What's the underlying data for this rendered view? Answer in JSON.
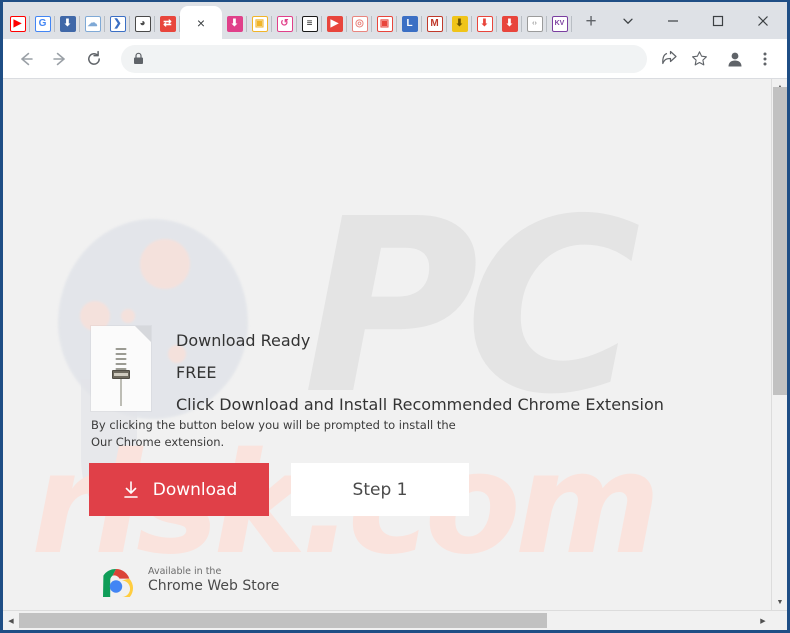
{
  "window": {
    "controls": [
      {
        "name": "tab-search-button",
        "glyph": "chevron-down-icon"
      },
      {
        "name": "minimize-button",
        "glyph": "minimize-icon"
      },
      {
        "name": "maximize-button",
        "glyph": "maximize-icon"
      },
      {
        "name": "close-button",
        "glyph": "close-icon"
      }
    ]
  },
  "tabstrip": {
    "new_tab_label": "+",
    "active_tab_close_label": "×",
    "tabs": [
      {
        "title": "YouTube",
        "icon": "youtube-favicon",
        "bg": "#ffffff",
        "fg": "#ff0000",
        "letter": "▶"
      },
      {
        "title": "Google",
        "icon": "google-favicon",
        "bg": "#ffffff",
        "fg": "#4285f4",
        "letter": "G"
      },
      {
        "title": "Downloader",
        "icon": "download-favicon",
        "bg": "#4068a8",
        "fg": "#ffffff",
        "letter": "⬇"
      },
      {
        "title": "Cloud Download",
        "icon": "cloud-download-favicon",
        "bg": "#ffffff",
        "fg": "#7fa9d6",
        "letter": "☁"
      },
      {
        "title": "Chevron App",
        "icon": "chevron-favicon",
        "bg": "#ffffff",
        "fg": "#3b6fc4",
        "letter": "❯"
      },
      {
        "title": "Globe App",
        "icon": "globe-favicon",
        "bg": "#ffffff",
        "fg": "#4a4a4a",
        "letter": "◕"
      },
      {
        "title": "Converter",
        "icon": "converter-favicon",
        "bg": "#e8453c",
        "fg": "#ffffff",
        "letter": "⇄"
      },
      {
        "title": "Active Tab",
        "icon": "active-tab",
        "bg": "#ffffff",
        "fg": "#3c4043",
        "letter": ""
      },
      {
        "title": "Downloader Pink",
        "icon": "download-pink-favicon",
        "bg": "#e0408a",
        "fg": "#ffffff",
        "letter": "⬇"
      },
      {
        "title": "Video Camera",
        "icon": "camera-favicon",
        "bg": "#ffffff",
        "fg": "#f0b429",
        "letter": "▣"
      },
      {
        "title": "Loop Converter",
        "icon": "loop-favicon",
        "bg": "#ffffff",
        "fg": "#e0408a",
        "letter": "↺"
      },
      {
        "title": "Three Bars",
        "icon": "bars-favicon",
        "bg": "#ffffff",
        "fg": "#1a1a1a",
        "letter": "≡"
      },
      {
        "title": "Red Play",
        "icon": "red-play-favicon",
        "bg": "#e8453c",
        "fg": "#ffffff",
        "letter": "▶"
      },
      {
        "title": "Pin Locator",
        "icon": "pin-favicon",
        "bg": "#ffffff",
        "fg": "#e8857f",
        "letter": "◎"
      },
      {
        "title": "Video Box",
        "icon": "video-box-favicon",
        "bg": "#ffffff",
        "fg": "#e8453c",
        "letter": "▣"
      },
      {
        "title": "L App",
        "icon": "l-favicon",
        "bg": "#3b6fc4",
        "fg": "#ffffff",
        "letter": "L"
      },
      {
        "title": "YM App",
        "icon": "ym-favicon",
        "bg": "#ffffff",
        "fg": "#c0392b",
        "letter": "M"
      },
      {
        "title": "Yellow Download",
        "icon": "yellow-download-favicon",
        "bg": "#f0c419",
        "fg": "#6b5400",
        "letter": "⬇"
      },
      {
        "title": "Red Heart Download",
        "icon": "red-download-favicon",
        "bg": "#ffffff",
        "fg": "#e8453c",
        "letter": "⬇"
      },
      {
        "title": "Pink Download",
        "icon": "pink-download-favicon",
        "bg": "#e8453c",
        "fg": "#ffffff",
        "letter": "⬇"
      },
      {
        "title": "Code Viewer",
        "icon": "code-favicon",
        "bg": "#ffffff",
        "fg": "#9b9b9b",
        "letter": "‹›"
      },
      {
        "title": "KV App",
        "icon": "kv-favicon",
        "bg": "#ffffff",
        "fg": "#7b3fa0",
        "letter": "KV"
      },
      {
        "title": "Circle Download",
        "icon": "circle-download-favicon",
        "bg": "#ffffff",
        "fg": "#c0392b",
        "letter": "⬇"
      },
      {
        "title": "Save Tool",
        "icon": "save-favicon",
        "bg": "#ffffff",
        "fg": "#e8675f",
        "letter": "⬇"
      },
      {
        "title": "Chart App",
        "icon": "chart-favicon",
        "bg": "#3d9140",
        "fg": "#ffffff",
        "letter": "▐█"
      },
      {
        "title": "Cloud App",
        "icon": "cloud-favicon",
        "bg": "#ffffff",
        "fg": "#7fa9d6",
        "letter": "☁"
      }
    ]
  },
  "toolbar": {
    "back_label": "Back",
    "forward_label": "Forward",
    "reload_label": "Reload",
    "omnibox_value": "",
    "omnibox_placeholder": "",
    "lock_label": "View site information",
    "share_label": "Share this page",
    "bookmark_label": "Bookmark this tab",
    "profile_label": "Profile",
    "menu_label": "Customize and control Google Chrome"
  },
  "page": {
    "watermark_primary": "PC",
    "watermark_secondary": "risk.com",
    "hero": {
      "line1": "Download Ready",
      "line2": "FREE",
      "line3": "Click Download and Install Recommended Chrome Extension",
      "file_icon": "zip-file-icon"
    },
    "subtext_line1": "By clicking the button below you will be prompted to install the",
    "subtext_line2": "Our Chrome extension.",
    "buttons": {
      "download_label": "Download",
      "download_icon": "download-arrow-icon",
      "download_color": "#e04048",
      "step_label": "Step 1",
      "step_color": "#ffffff"
    },
    "chrome_web_store": {
      "available_text": "Available in the",
      "store_text": "Chrome Web Store",
      "logo": "chrome-logo-icon"
    }
  },
  "scrollbars": {
    "vertical_up": "▲",
    "vertical_down": "▼",
    "horizontal_left": "◀",
    "horizontal_right": "▶"
  }
}
